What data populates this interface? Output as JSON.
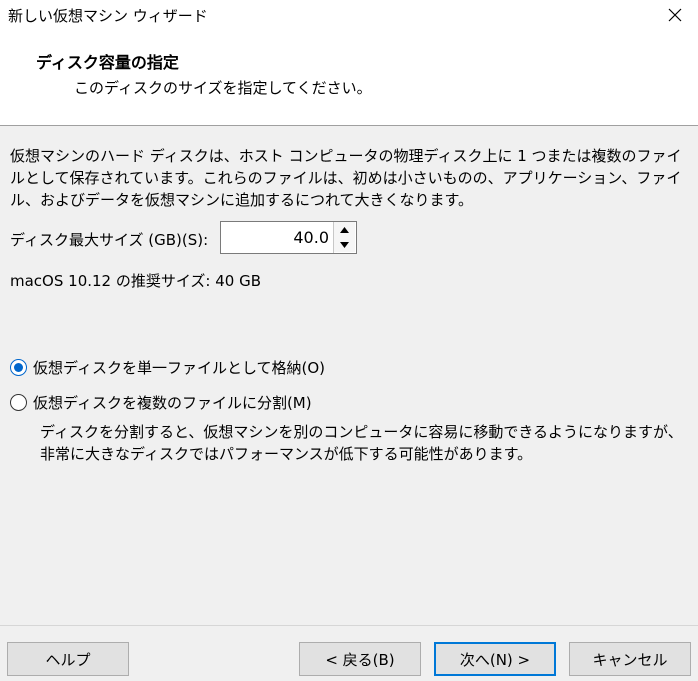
{
  "window": {
    "title": "新しい仮想マシン ウィザード",
    "close_icon": "close-icon"
  },
  "header": {
    "title": "ディスク容量の指定",
    "subtitle": "このディスクのサイズを指定してください。"
  },
  "main": {
    "description": "仮想マシンのハード ディスクは、ホスト コンピュータの物理ディスク上に 1 つまたは複数のファイルとして保存されています。これらのファイルは、初めは小さいものの、アプリケーション、ファイル、およびデータを仮想マシンに追加するにつれて大きくなります。",
    "size_label": "ディスク最大サイズ (GB)(S):",
    "size_value": "40.0",
    "recommended": "macOS 10.12 の推奨サイズ: 40 GB",
    "options": [
      {
        "label": "仮想ディスクを単一ファイルとして格納(O)",
        "checked": true
      },
      {
        "label": "仮想ディスクを複数のファイルに分割(M)",
        "checked": false
      }
    ],
    "split_description": "ディスクを分割すると、仮想マシンを別のコンピュータに容易に移動できるようになりますが、非常に大きなディスクではパフォーマンスが低下する可能性があります。"
  },
  "footer": {
    "help": "ヘルプ",
    "back": "< 戻る(B)",
    "next": "次へ(N) >",
    "cancel": "キャンセル"
  },
  "colors": {
    "accent": "#0078d7",
    "radio_selected": "#0066cc"
  }
}
